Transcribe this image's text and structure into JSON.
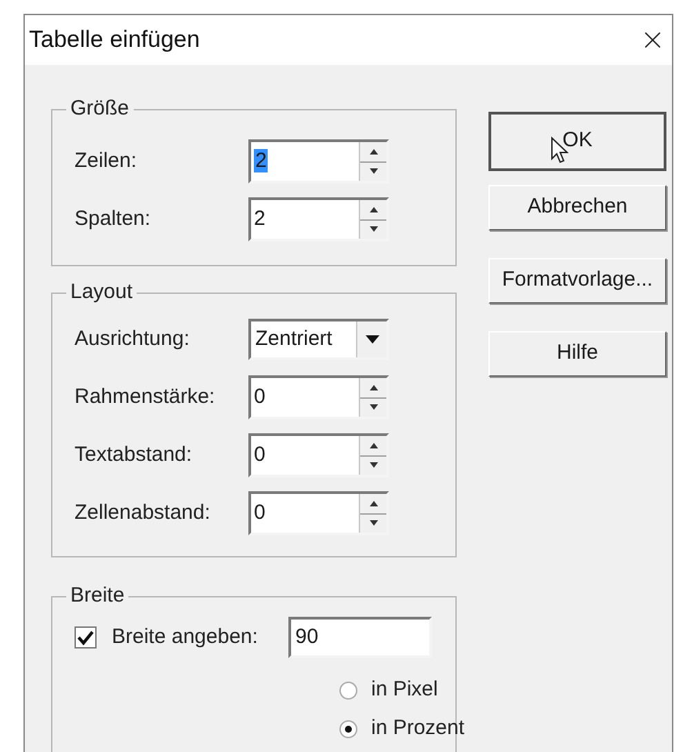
{
  "window": {
    "title": "Tabelle einfügen"
  },
  "groups": [
    {
      "title": "Größe",
      "rows": [
        {
          "kind": "spin",
          "label": "Zeilen:",
          "value": "2",
          "selected": true
        },
        {
          "kind": "spin",
          "label": "Spalten:",
          "value": "2",
          "selected": false
        }
      ]
    },
    {
      "title": "Layout",
      "rows": [
        {
          "kind": "dropdown",
          "label": "Ausrichtung:",
          "value": "Zentriert"
        },
        {
          "kind": "spin",
          "label": "Rahmenstärke:",
          "value": "0",
          "selected": false
        },
        {
          "kind": "spin",
          "label": "Textabstand:",
          "value": "0",
          "selected": false
        },
        {
          "kind": "spin",
          "label": "Zellenabstand:",
          "value": "0",
          "selected": false
        }
      ]
    }
  ],
  "width_group": {
    "title": "Breite",
    "checkbox": {
      "label": "Breite angeben:",
      "checked": true,
      "value": "90"
    },
    "radios": [
      {
        "label": "in Pixel",
        "selected": false
      },
      {
        "label": "in Prozent",
        "selected": true
      }
    ]
  },
  "buttons": [
    {
      "label": "OK",
      "default": true
    },
    {
      "label": "Abbrechen",
      "default": false
    },
    {
      "label": "Formatvorlage...",
      "default": false
    },
    {
      "label": "Hilfe",
      "default": false
    }
  ]
}
